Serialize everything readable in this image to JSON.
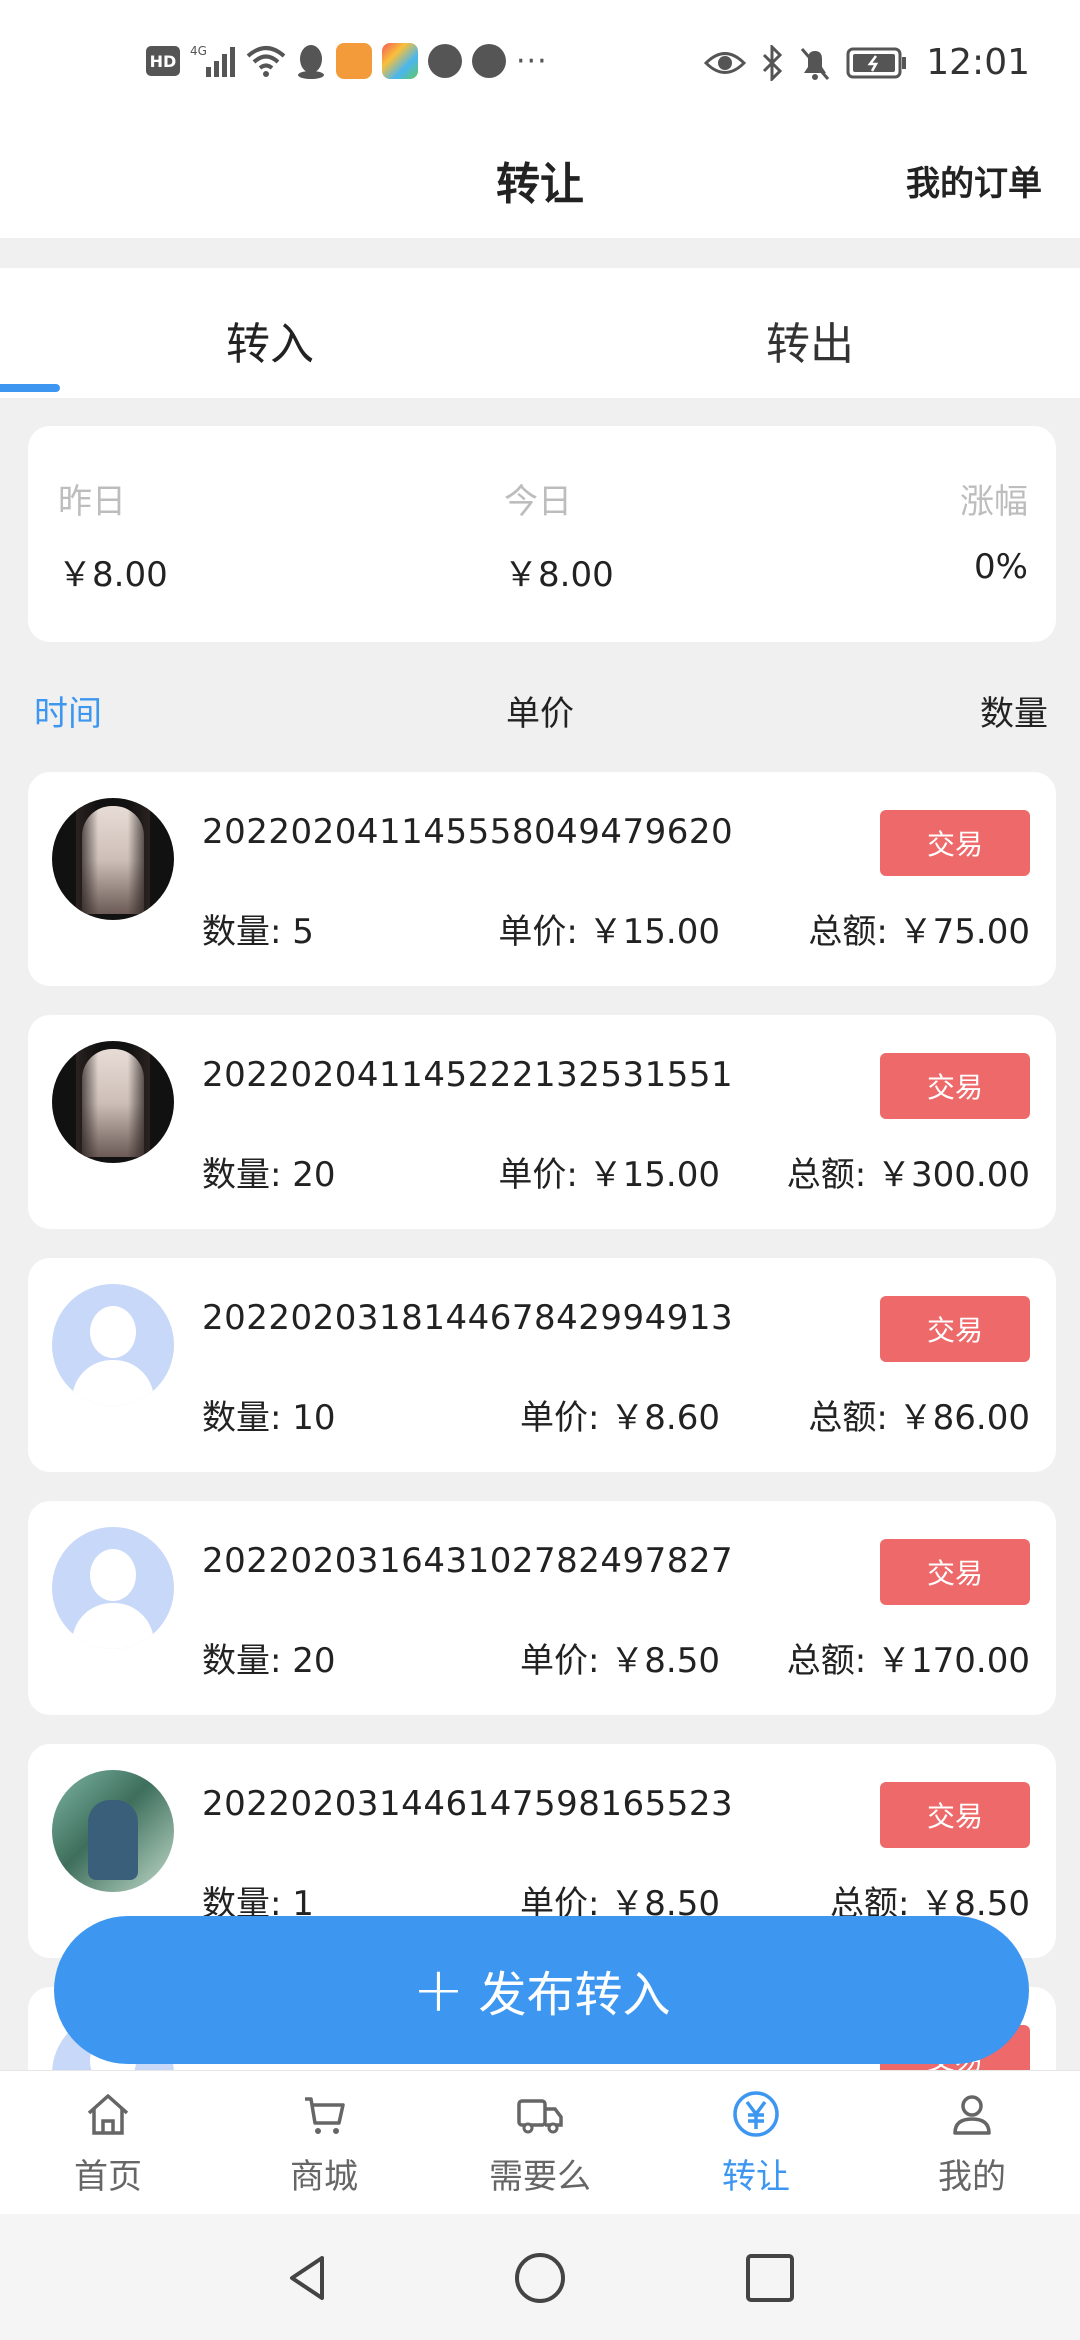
{
  "status_bar": {
    "hd": "HD",
    "network": "4G",
    "time": "12:01",
    "more": "···"
  },
  "header": {
    "title": "转让",
    "right_link": "我的订单"
  },
  "tabs": [
    {
      "label": "转入",
      "active": true
    },
    {
      "label": "转出",
      "active": false
    }
  ],
  "summary": {
    "yesterday_label": "昨日",
    "yesterday_value": "￥8.00",
    "today_label": "今日",
    "today_value": "￥8.00",
    "change_label": "涨幅",
    "change_value": "0%"
  },
  "columns": {
    "time": "时间",
    "price": "单价",
    "qty": "数量"
  },
  "orders": [
    {
      "id": "20220204114555804947962​0",
      "qty": "数量: 5",
      "price": "单价: ￥15.00",
      "total": "总额: ￥75.00",
      "action": "交易",
      "avatar": "photo-a"
    },
    {
      "id": "2022020411452221325315​51",
      "qty": "数量: 20",
      "price": "单价: ￥15.00",
      "total": "总额: ￥300.00",
      "action": "交易",
      "avatar": "photo-a"
    },
    {
      "id": "2022020318144678429949​13",
      "qty": "数量: 10",
      "price": "单价: ￥8.60",
      "total": "总额: ￥86.00",
      "action": "交易",
      "avatar": "default"
    },
    {
      "id": "2022020316431027824978​27",
      "qty": "数量: 20",
      "price": "单价: ￥8.50",
      "total": "总额: ￥170.00",
      "action": "交易",
      "avatar": "default"
    },
    {
      "id": "2022020314461475981655​23",
      "qty": "数量: 1",
      "price": "单价: ￥8.50",
      "total": "总额: ￥8.50",
      "action": "交易",
      "avatar": "photo-b"
    }
  ],
  "fab": {
    "plus": "+",
    "label": "发布转入"
  },
  "bottom_nav": [
    {
      "label": "首页",
      "icon": "home-icon"
    },
    {
      "label": "商城",
      "icon": "cart-icon"
    },
    {
      "label": "需要么",
      "icon": "truck-icon"
    },
    {
      "label": "转让",
      "icon": "yen-icon",
      "active": true
    },
    {
      "label": "我的",
      "icon": "user-icon"
    }
  ],
  "colors": {
    "accent": "#3d97f1",
    "trade_button": "#ee6a6a"
  }
}
